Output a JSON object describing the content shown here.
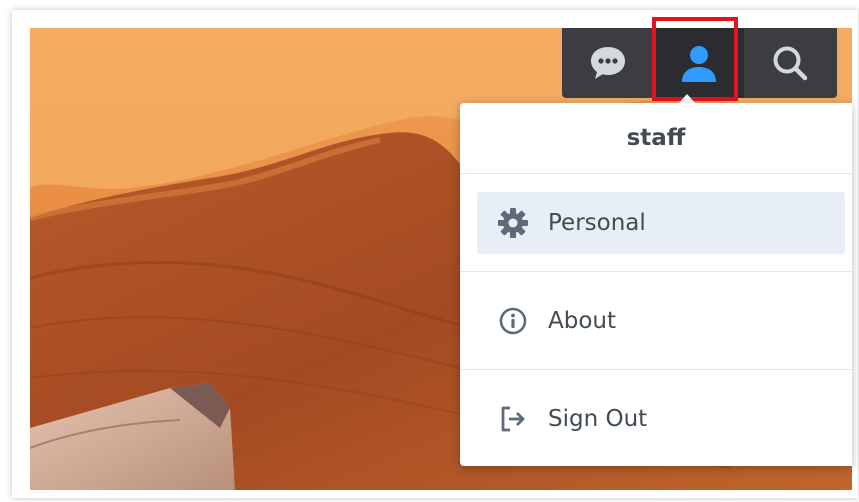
{
  "taskbar": {
    "buttons": [
      {
        "name": "notifications",
        "icon": "chat-bubble-icon"
      },
      {
        "name": "user",
        "icon": "user-icon"
      },
      {
        "name": "search",
        "icon": "search-icon"
      }
    ],
    "active_color": "#2f9bff",
    "highlight_color": "#e0141c"
  },
  "user_menu": {
    "username": "staff",
    "items": [
      {
        "label": "Personal",
        "icon": "gear-icon"
      },
      {
        "label": "About",
        "icon": "info-icon"
      },
      {
        "label": "Sign Out",
        "icon": "sign-out-icon"
      }
    ]
  }
}
